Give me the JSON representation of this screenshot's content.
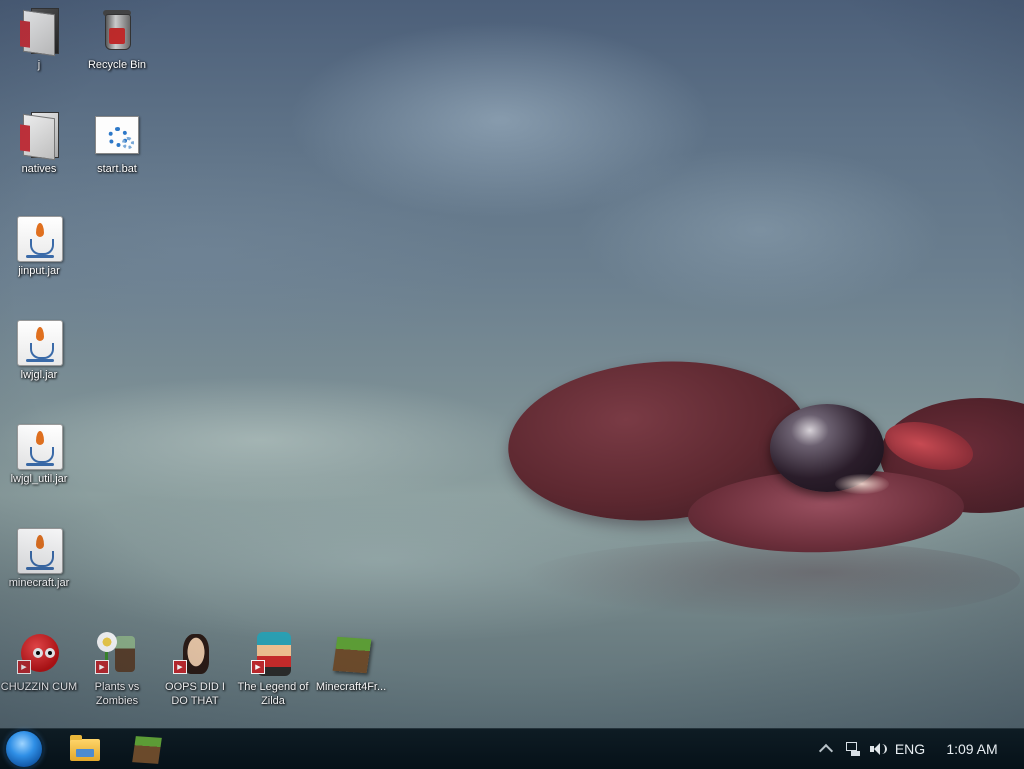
{
  "desktop": {
    "icons": [
      {
        "id": "j",
        "label": "j",
        "icon": "folder-icon"
      },
      {
        "id": "recycle-bin",
        "label": "Recycle Bin",
        "icon": "recycle-bin-icon"
      },
      {
        "id": "natives",
        "label": "natives",
        "icon": "folder-icon"
      },
      {
        "id": "start-bat",
        "label": "start.bat",
        "icon": "batch-file-icon"
      },
      {
        "id": "jinput-jar",
        "label": "jinput.jar",
        "icon": "java-jar-icon"
      },
      {
        "id": "lwjgl-jar",
        "label": "lwjgl.jar",
        "icon": "java-jar-icon"
      },
      {
        "id": "lwjgl-util-jar",
        "label": "lwjgl_util.jar",
        "icon": "java-jar-icon"
      },
      {
        "id": "minecraft-jar",
        "label": "minecraft.jar",
        "icon": "java-jar-icon"
      },
      {
        "id": "chuzzin-cum",
        "label": "CHUZZIN CUM",
        "icon": "game-shortcut-icon"
      },
      {
        "id": "plants-vs-zombies",
        "label": "Plants vs Zombies",
        "icon": "game-shortcut-icon"
      },
      {
        "id": "oops-did-i-do-that",
        "label": "OOPS DID I DO THAT",
        "icon": "game-shortcut-icon"
      },
      {
        "id": "legend-of-zilda",
        "label": "The Legend of Zilda",
        "icon": "game-shortcut-icon"
      },
      {
        "id": "minecraft4fr",
        "label": "Minecraft4Fr...",
        "icon": "minecraft-icon"
      }
    ]
  },
  "taskbar": {
    "start_icon": "start-orb-icon",
    "pinned": [
      {
        "id": "explorer",
        "icon": "file-explorer-icon"
      },
      {
        "id": "minecraft",
        "icon": "minecraft-icon"
      }
    ],
    "tray": {
      "chevron_icon": "show-hidden-icons-icon",
      "network_icon": "network-icon",
      "volume_icon": "volume-icon",
      "language": "ENG",
      "time": "1:09 AM"
    }
  },
  "colors": {
    "taskbar_bg": "#0a1820",
    "start_orb": "#2f8fe6",
    "petal": "#6c2f3b"
  }
}
